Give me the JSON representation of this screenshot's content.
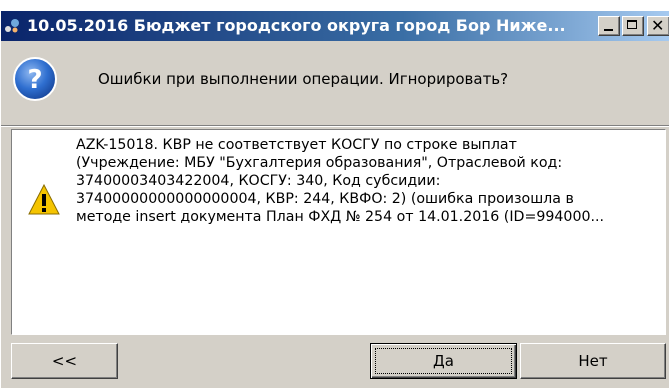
{
  "window": {
    "title": "10.05.2016 Бюджет городского округа город Бор Ниже...",
    "title_icon": "app-icon",
    "controls": {
      "minimize_icon": "minimize-icon",
      "maximize_icon": "maximize-icon",
      "close_icon": "close-icon",
      "close_glyph": "✕"
    }
  },
  "dialog": {
    "question_icon": "question-icon",
    "question": "Ошибки при выполнении операции. Игнорировать?",
    "warning_icon": "warning-icon",
    "message_lines": [
      "AZK-15018. КВР не соответствует КОСГУ по строке выплат",
      "(Учреждение: МБУ \"Бухгалтерия образования\", Отраслевой код:",
      "37400003403422004, КОСГУ: 340, Код субсидии:",
      "37400000000000000004, КВР: 244, КВФО: 2) (ошибка произошла в",
      "методе insert документа План ФХД № 254 от 14.01.2016 (ID=994000..."
    ]
  },
  "buttons": {
    "back": "<<",
    "yes": "Да",
    "no": "Нет"
  },
  "colors": {
    "title_gradient_start": "#0a246a",
    "title_gradient_end": "#a6caf0",
    "face": "#d4d0c8",
    "question_icon": "#1f5fbf",
    "warning_icon": "#f5c400"
  }
}
